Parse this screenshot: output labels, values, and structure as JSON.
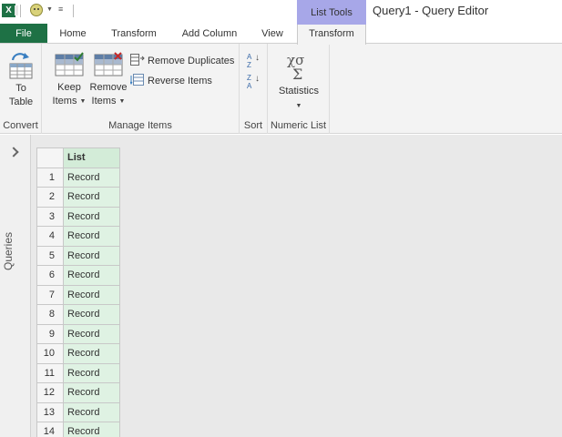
{
  "titlebar": {
    "app_icon_text": "X",
    "context_tab_label": "List Tools",
    "window_title": "Query1 - Query Editor"
  },
  "tabs": [
    {
      "label": "File"
    },
    {
      "label": "Home"
    },
    {
      "label": "Transform"
    },
    {
      "label": "Add Column"
    },
    {
      "label": "View"
    },
    {
      "label": "Transform"
    }
  ],
  "ribbon": {
    "convert": {
      "to_table_line1": "To",
      "to_table_line2": "Table",
      "label": "Convert"
    },
    "manage_items": {
      "keep_line1": "Keep",
      "keep_line2": "Items",
      "remove_line1": "Remove",
      "remove_line2": "Items",
      "remove_duplicates": "Remove Duplicates",
      "reverse_items": "Reverse Items",
      "label": "Manage Items"
    },
    "sort": {
      "asc_top": "A",
      "asc_bottom": "Z",
      "desc_top": "Z",
      "desc_bottom": "A",
      "label": "Sort"
    },
    "numeric_list": {
      "statistics": "Statistics",
      "label": "Numeric List"
    }
  },
  "queries_pane": {
    "label": "Queries"
  },
  "grid": {
    "column_header": "List",
    "rows": [
      {
        "n": "1",
        "value": "Record"
      },
      {
        "n": "2",
        "value": "Record"
      },
      {
        "n": "3",
        "value": "Record"
      },
      {
        "n": "4",
        "value": "Record"
      },
      {
        "n": "5",
        "value": "Record"
      },
      {
        "n": "6",
        "value": "Record"
      },
      {
        "n": "7",
        "value": "Record"
      },
      {
        "n": "8",
        "value": "Record"
      },
      {
        "n": "9",
        "value": "Record"
      },
      {
        "n": "10",
        "value": "Record"
      },
      {
        "n": "11",
        "value": "Record"
      },
      {
        "n": "12",
        "value": "Record"
      },
      {
        "n": "13",
        "value": "Record"
      },
      {
        "n": "14",
        "value": "Record"
      }
    ]
  },
  "colors": {
    "excel_green": "#1e7145",
    "context_tab": "#a7a7e8",
    "column_header_bg": "#d3ecd8",
    "cell_bg": "#dff2e3"
  }
}
